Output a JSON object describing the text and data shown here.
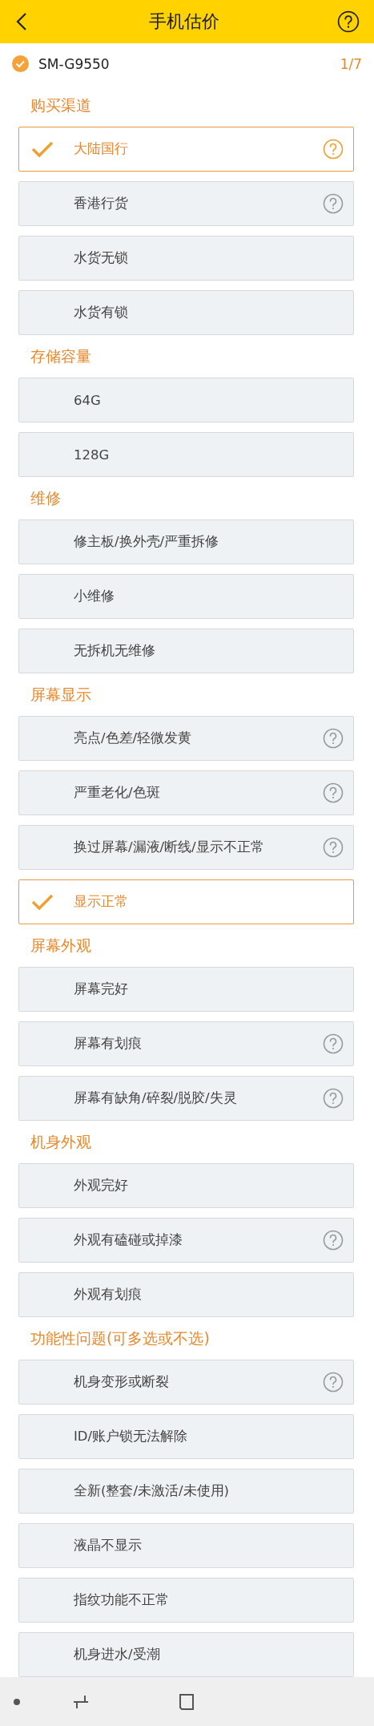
{
  "header": {
    "title": "手机估价"
  },
  "model": {
    "name": "SM-G9550",
    "checked": true,
    "progress": "1/7"
  },
  "sections": [
    {
      "title": "购买渠道",
      "options": [
        {
          "label": "大陆国行",
          "selected": true,
          "help": true
        },
        {
          "label": "香港行货",
          "selected": false,
          "help": true
        },
        {
          "label": "水货无锁",
          "selected": false,
          "help": false
        },
        {
          "label": "水货有锁",
          "selected": false,
          "help": false
        }
      ]
    },
    {
      "title": "存储容量",
      "options": [
        {
          "label": "64G",
          "selected": false,
          "help": false
        },
        {
          "label": "128G",
          "selected": false,
          "help": false
        }
      ]
    },
    {
      "title": "维修",
      "options": [
        {
          "label": "修主板/换外壳/严重拆修",
          "selected": false,
          "help": false
        },
        {
          "label": "小维修",
          "selected": false,
          "help": false
        },
        {
          "label": "无拆机无维修",
          "selected": false,
          "help": false
        }
      ]
    },
    {
      "title": "屏幕显示",
      "options": [
        {
          "label": "亮点/色差/轻微发黄",
          "selected": false,
          "help": true
        },
        {
          "label": "严重老化/色斑",
          "selected": false,
          "help": true
        },
        {
          "label": "换过屏幕/漏液/断线/显示不正常",
          "selected": false,
          "help": true
        },
        {
          "label": "显示正常",
          "selected": true,
          "help": false
        }
      ]
    },
    {
      "title": "屏幕外观",
      "options": [
        {
          "label": "屏幕完好",
          "selected": false,
          "help": false
        },
        {
          "label": "屏幕有划痕",
          "selected": false,
          "help": true
        },
        {
          "label": "屏幕有缺角/碎裂/脱胶/失灵",
          "selected": false,
          "help": true
        }
      ]
    },
    {
      "title": "机身外观",
      "options": [
        {
          "label": "外观完好",
          "selected": false,
          "help": false
        },
        {
          "label": "外观有磕碰或掉漆",
          "selected": false,
          "help": true
        },
        {
          "label": "外观有划痕",
          "selected": false,
          "help": false
        }
      ]
    },
    {
      "title": "功能性问题(可多选或不选)",
      "options": [
        {
          "label": "机身变形或断裂",
          "selected": false,
          "help": true
        },
        {
          "label": "ID/账户锁无法解除",
          "selected": false,
          "help": false
        },
        {
          "label": "全新(整套/未激活/未使用)",
          "selected": false,
          "help": false
        },
        {
          "label": "液晶不显示",
          "selected": false,
          "help": false
        },
        {
          "label": "指纹功能不正常",
          "selected": false,
          "help": false
        },
        {
          "label": "机身进水/受潮",
          "selected": false,
          "help": false
        }
      ]
    }
  ]
}
